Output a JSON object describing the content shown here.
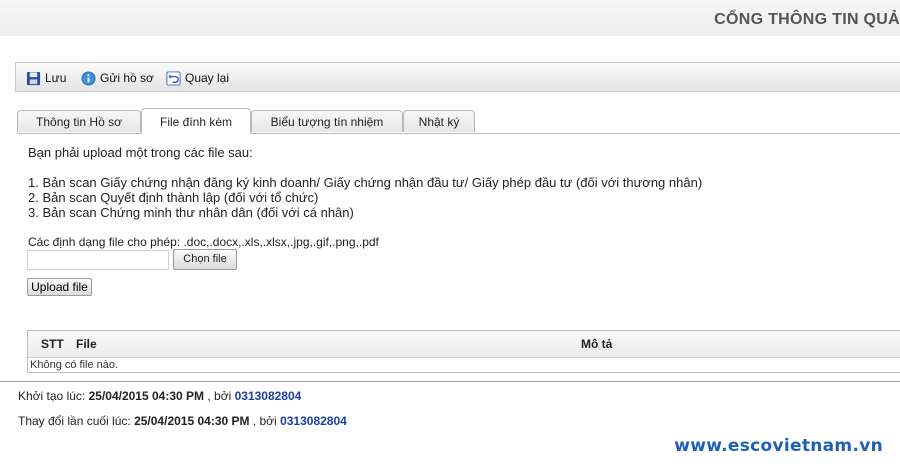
{
  "header": {
    "title": "CỔNG THÔNG TIN QUẢ"
  },
  "toolbar": {
    "save_label": "Lưu",
    "submit_label": "Gửi hồ sơ",
    "back_label": "Quay lại"
  },
  "tabs": [
    {
      "label": "Thông tin Hồ sơ",
      "active": false
    },
    {
      "label": "File đính kèm",
      "active": true
    },
    {
      "label": "Biểu tượng tín nhiệm",
      "active": false
    },
    {
      "label": "Nhật ký",
      "active": false
    }
  ],
  "content": {
    "intro": "Bạn phải upload một trong các file sau:",
    "requirements": [
      "1. Bản scan Giấy chứng nhận đăng ký kinh doanh/ Giấy chứng nhận đầu tư/ Giấy phép đầu tư (đối với thương nhân)",
      "2. Bản scan Quyết định thành lập (đối với tổ chức)",
      "3. Bản scan Chứng minh thư nhân dân (đối với cá nhân)"
    ],
    "formats": "Các định dạng file cho phép: .doc,.docx,.xls,.xlsx,.jpg,.gif,.png,.pdf",
    "choose_file_label": "Chọn file",
    "upload_label": "Upload file"
  },
  "table": {
    "headers": [
      "STT",
      "File",
      "Mô tả"
    ],
    "empty_text": "Không có file nào."
  },
  "meta": {
    "created_label": "Khởi tạo lúc:",
    "created_time": "25/04/2015 04:30 PM",
    "created_by_sep": ", bởi",
    "created_by": "0313082804",
    "modified_label": "Thay đổi lần cuối lúc:",
    "modified_time": "25/04/2015 04:30 PM",
    "modified_by_sep": ", bởi",
    "modified_by": "0313082804"
  },
  "watermark": "www.escovietnam.vn",
  "colors": {
    "link": "#1a3fa6",
    "watermark": "#1e5fb8"
  }
}
